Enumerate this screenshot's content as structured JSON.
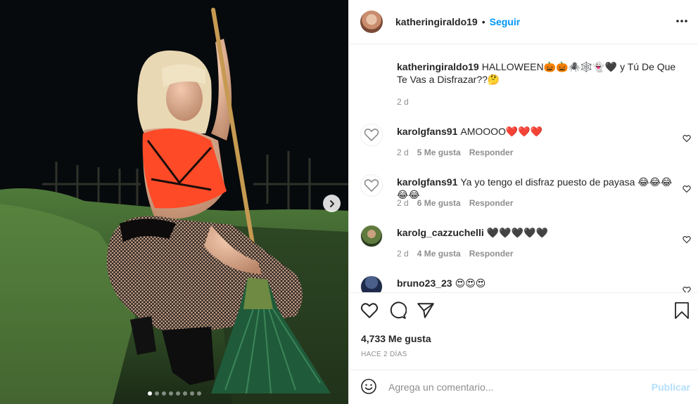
{
  "post": {
    "username": "katheringiraldo19",
    "follow_label": "Seguir",
    "separator": "•",
    "caption": {
      "user": "katheringiraldo19",
      "text": "HALLOWEEN🎃🎃🕷️🕸️👻🖤 y Tú De Que Te Vas a Disfrazar??🤔",
      "age": "2 d"
    },
    "carousel": {
      "total_slides": 8,
      "active_index": 0
    }
  },
  "comments": [
    {
      "user": "karolgfans91",
      "text": "AMOOOO❤️❤️❤️",
      "age": "2 d",
      "likes": "5 Me gusta",
      "reply": "Responder",
      "avatar_icon": "heart-outline-icon"
    },
    {
      "user": "karolgfans91",
      "text": "Ya yo tengo el disfraz puesto de payasa 😂😂😂😂😂",
      "age": "2 d",
      "likes": "6 Me gusta",
      "reply": "Responder",
      "avatar_icon": "heart-outline-icon"
    },
    {
      "user": "karolg_cazzuchelli",
      "text": "🖤🖤🖤🖤🖤",
      "age": "2 d",
      "likes": "4 Me gusta",
      "reply": "Responder",
      "avatar_icon": "photo-avatar"
    },
    {
      "user": "bruno23_23",
      "text": "😍😍😍",
      "age": "",
      "likes": "",
      "reply": "",
      "avatar_icon": "photo-avatar"
    }
  ],
  "actions": {
    "likes_count": "4,733 Me gusta",
    "time_ago": "HACE 2 DÍAS"
  },
  "add_comment": {
    "placeholder": "Agrega un comentario...",
    "post_label": "Publicar"
  },
  "colors": {
    "accent": "#0095f6",
    "post_disabled": "#b2dffc",
    "muted": "#8e8e8e",
    "text": "#262626"
  }
}
